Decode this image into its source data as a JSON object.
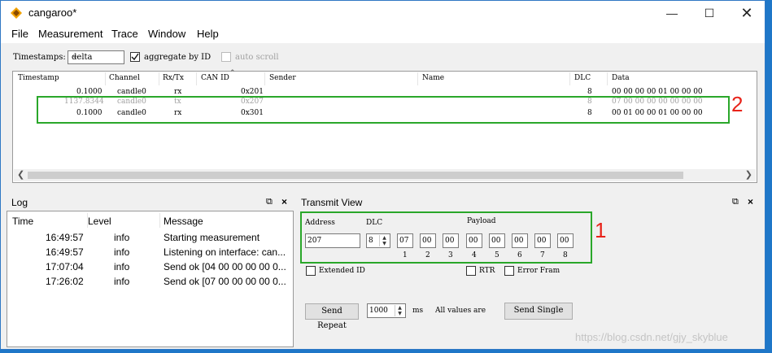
{
  "window": {
    "title": "cangaroo*",
    "min_icon": "minimize-icon",
    "max_icon": "maximize-icon",
    "close_icon": "close-icon"
  },
  "menu": [
    "File",
    "Measurement",
    "Trace",
    "Window",
    "Help"
  ],
  "toolbar": {
    "timestamps_label": "Timestamps:",
    "timestamps_value": "delta",
    "aggregate_label": "aggregate by ID",
    "autoscroll_label": "auto scroll",
    "aggregate_checked": true
  },
  "trace": {
    "columns": [
      "Timestamp",
      "Channel",
      "Rx/Tx",
      "CAN ID",
      "Sender",
      "Name",
      "DLC",
      "Data"
    ],
    "rows": [
      {
        "timestamp": "0.1000",
        "channel": "candle0",
        "rxtx": "rx",
        "can_id": "0x201",
        "dlc": "8",
        "data": "00 00 00 00 01 00 00 00",
        "grey": false
      },
      {
        "timestamp": "1137.8344",
        "channel": "candle0",
        "rxtx": "tx",
        "can_id": "0x207",
        "dlc": "8",
        "data": "07 00 00 00 00 00 00 00",
        "grey": true
      },
      {
        "timestamp": "0.1000",
        "channel": "candle0",
        "rxtx": "rx",
        "can_id": "0x301",
        "dlc": "8",
        "data": "00 01 00 00 01 00 00 00",
        "grey": false
      }
    ]
  },
  "log": {
    "title": "Log",
    "columns": [
      "Time",
      "Level",
      "Message"
    ],
    "rows": [
      {
        "time": "16:49:57",
        "level": "info",
        "message": "Starting measurement"
      },
      {
        "time": "16:49:57",
        "level": "info",
        "message": "Listening on interface: can..."
      },
      {
        "time": "17:07:04",
        "level": "info",
        "message": "Send ok [04 00 00 00 00 0..."
      },
      {
        "time": "17:26:02",
        "level": "info",
        "message": "Send ok [07 00 00 00 00 0..."
      }
    ]
  },
  "transmit": {
    "title": "Transmit View",
    "address_label": "Address",
    "address_value": "207",
    "dlc_label": "DLC",
    "dlc_value": "8",
    "payload_label": "Payload",
    "payload": [
      "07",
      "00",
      "00",
      "00",
      "00",
      "00",
      "00",
      "00"
    ],
    "payload_idx": [
      "1",
      "2",
      "3",
      "4",
      "5",
      "6",
      "7",
      "8"
    ],
    "extended_id": "Extended ID",
    "rtr": "RTR",
    "error_frame": "Error Fram",
    "send_repeat": "Send Repeat",
    "repeat_value": "1000",
    "ms": "ms",
    "all_values": "All values are",
    "send_single": "Send Single"
  },
  "annotations": {
    "one": "1",
    "two": "2"
  },
  "watermark": "https://blog.csdn.net/gjy_skyblue",
  "colors": {
    "highlight": "#2aa72a",
    "annotation": "#e8231a",
    "accent": "#1f77c8"
  }
}
